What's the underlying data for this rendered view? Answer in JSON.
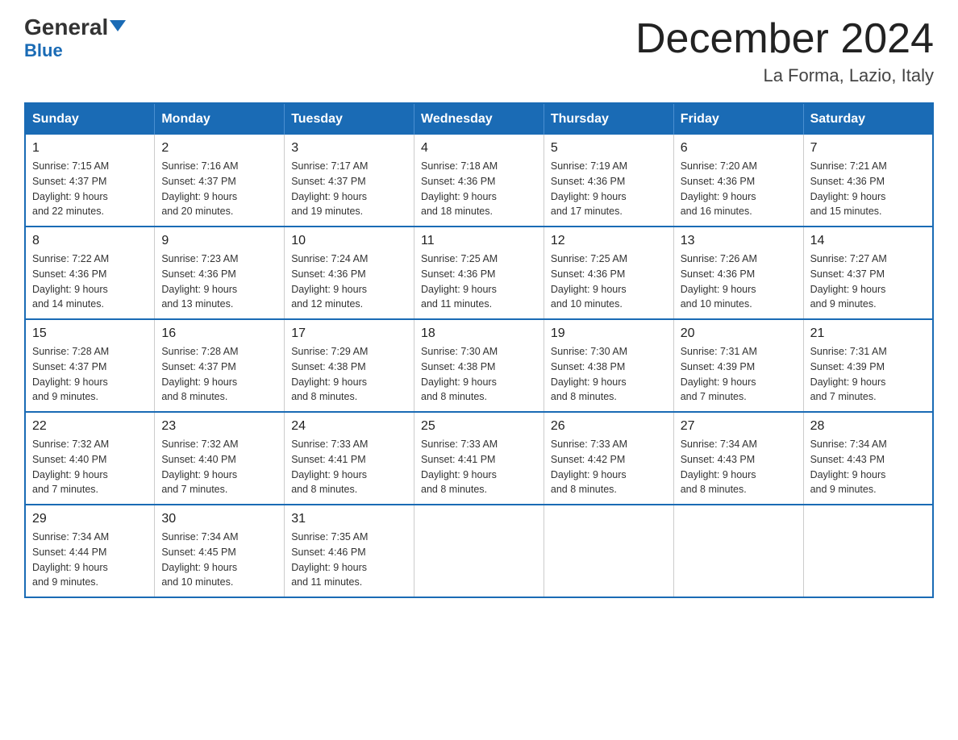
{
  "logo": {
    "text_general": "General",
    "text_blue": "Blue"
  },
  "header": {
    "month": "December 2024",
    "location": "La Forma, Lazio, Italy"
  },
  "days_of_week": [
    "Sunday",
    "Monday",
    "Tuesday",
    "Wednesday",
    "Thursday",
    "Friday",
    "Saturday"
  ],
  "weeks": [
    [
      {
        "day": "1",
        "sunrise": "7:15 AM",
        "sunset": "4:37 PM",
        "daylight": "9 hours and 22 minutes."
      },
      {
        "day": "2",
        "sunrise": "7:16 AM",
        "sunset": "4:37 PM",
        "daylight": "9 hours and 20 minutes."
      },
      {
        "day": "3",
        "sunrise": "7:17 AM",
        "sunset": "4:37 PM",
        "daylight": "9 hours and 19 minutes."
      },
      {
        "day": "4",
        "sunrise": "7:18 AM",
        "sunset": "4:36 PM",
        "daylight": "9 hours and 18 minutes."
      },
      {
        "day": "5",
        "sunrise": "7:19 AM",
        "sunset": "4:36 PM",
        "daylight": "9 hours and 17 minutes."
      },
      {
        "day": "6",
        "sunrise": "7:20 AM",
        "sunset": "4:36 PM",
        "daylight": "9 hours and 16 minutes."
      },
      {
        "day": "7",
        "sunrise": "7:21 AM",
        "sunset": "4:36 PM",
        "daylight": "9 hours and 15 minutes."
      }
    ],
    [
      {
        "day": "8",
        "sunrise": "7:22 AM",
        "sunset": "4:36 PM",
        "daylight": "9 hours and 14 minutes."
      },
      {
        "day": "9",
        "sunrise": "7:23 AM",
        "sunset": "4:36 PM",
        "daylight": "9 hours and 13 minutes."
      },
      {
        "day": "10",
        "sunrise": "7:24 AM",
        "sunset": "4:36 PM",
        "daylight": "9 hours and 12 minutes."
      },
      {
        "day": "11",
        "sunrise": "7:25 AM",
        "sunset": "4:36 PM",
        "daylight": "9 hours and 11 minutes."
      },
      {
        "day": "12",
        "sunrise": "7:25 AM",
        "sunset": "4:36 PM",
        "daylight": "9 hours and 10 minutes."
      },
      {
        "day": "13",
        "sunrise": "7:26 AM",
        "sunset": "4:36 PM",
        "daylight": "9 hours and 10 minutes."
      },
      {
        "day": "14",
        "sunrise": "7:27 AM",
        "sunset": "4:37 PM",
        "daylight": "9 hours and 9 minutes."
      }
    ],
    [
      {
        "day": "15",
        "sunrise": "7:28 AM",
        "sunset": "4:37 PM",
        "daylight": "9 hours and 9 minutes."
      },
      {
        "day": "16",
        "sunrise": "7:28 AM",
        "sunset": "4:37 PM",
        "daylight": "9 hours and 8 minutes."
      },
      {
        "day": "17",
        "sunrise": "7:29 AM",
        "sunset": "4:38 PM",
        "daylight": "9 hours and 8 minutes."
      },
      {
        "day": "18",
        "sunrise": "7:30 AM",
        "sunset": "4:38 PM",
        "daylight": "9 hours and 8 minutes."
      },
      {
        "day": "19",
        "sunrise": "7:30 AM",
        "sunset": "4:38 PM",
        "daylight": "9 hours and 8 minutes."
      },
      {
        "day": "20",
        "sunrise": "7:31 AM",
        "sunset": "4:39 PM",
        "daylight": "9 hours and 7 minutes."
      },
      {
        "day": "21",
        "sunrise": "7:31 AM",
        "sunset": "4:39 PM",
        "daylight": "9 hours and 7 minutes."
      }
    ],
    [
      {
        "day": "22",
        "sunrise": "7:32 AM",
        "sunset": "4:40 PM",
        "daylight": "9 hours and 7 minutes."
      },
      {
        "day": "23",
        "sunrise": "7:32 AM",
        "sunset": "4:40 PM",
        "daylight": "9 hours and 7 minutes."
      },
      {
        "day": "24",
        "sunrise": "7:33 AM",
        "sunset": "4:41 PM",
        "daylight": "9 hours and 8 minutes."
      },
      {
        "day": "25",
        "sunrise": "7:33 AM",
        "sunset": "4:41 PM",
        "daylight": "9 hours and 8 minutes."
      },
      {
        "day": "26",
        "sunrise": "7:33 AM",
        "sunset": "4:42 PM",
        "daylight": "9 hours and 8 minutes."
      },
      {
        "day": "27",
        "sunrise": "7:34 AM",
        "sunset": "4:43 PM",
        "daylight": "9 hours and 8 minutes."
      },
      {
        "day": "28",
        "sunrise": "7:34 AM",
        "sunset": "4:43 PM",
        "daylight": "9 hours and 9 minutes."
      }
    ],
    [
      {
        "day": "29",
        "sunrise": "7:34 AM",
        "sunset": "4:44 PM",
        "daylight": "9 hours and 9 minutes."
      },
      {
        "day": "30",
        "sunrise": "7:34 AM",
        "sunset": "4:45 PM",
        "daylight": "9 hours and 10 minutes."
      },
      {
        "day": "31",
        "sunrise": "7:35 AM",
        "sunset": "4:46 PM",
        "daylight": "9 hours and 11 minutes."
      },
      null,
      null,
      null,
      null
    ]
  ],
  "labels": {
    "sunrise": "Sunrise:",
    "sunset": "Sunset:",
    "daylight": "Daylight:"
  }
}
